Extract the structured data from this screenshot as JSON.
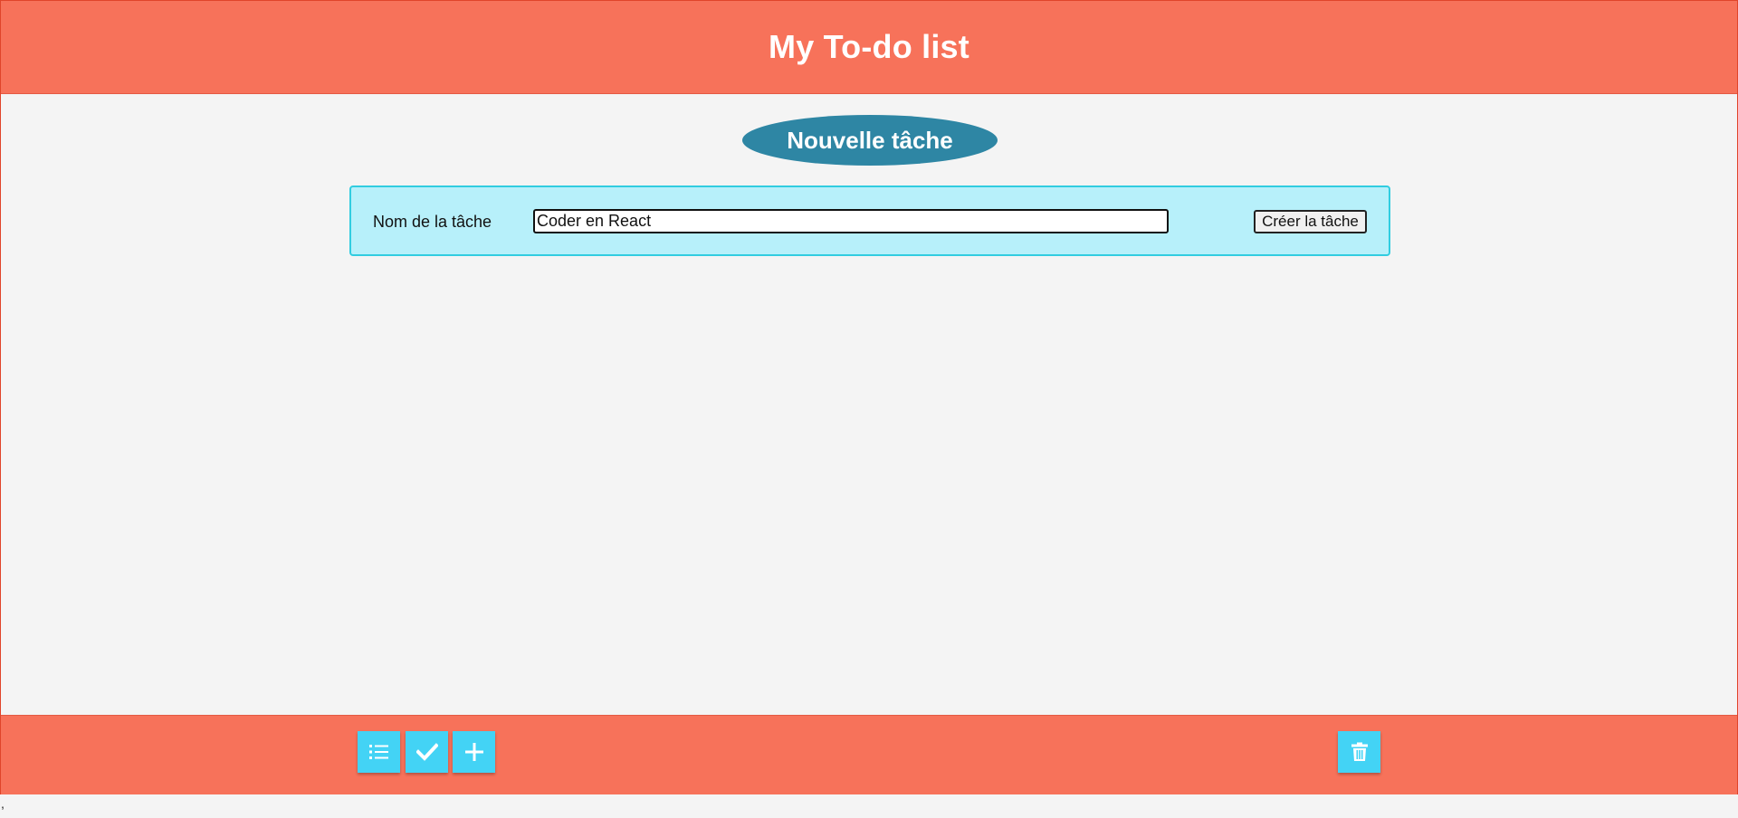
{
  "header": {
    "title": "My To-do list"
  },
  "section": {
    "title": "Nouvelle tâche"
  },
  "form": {
    "label": "Nom de la tâche",
    "input_value": "Coder en React",
    "submit_label": "Créer la tâche"
  },
  "footer": {
    "buttons": [
      {
        "icon": "list-icon"
      },
      {
        "icon": "check-icon"
      },
      {
        "icon": "plus-icon"
      },
      {
        "icon": "trash-icon"
      }
    ]
  },
  "page_trailing_text": ",",
  "colors": {
    "header_bg": "#f7725a",
    "pill_bg": "#2e86a4",
    "form_bg": "#b7f0fa",
    "form_border": "#31cde0",
    "button_bg": "#43d3f5",
    "page_bg": "#f4f4f4"
  }
}
